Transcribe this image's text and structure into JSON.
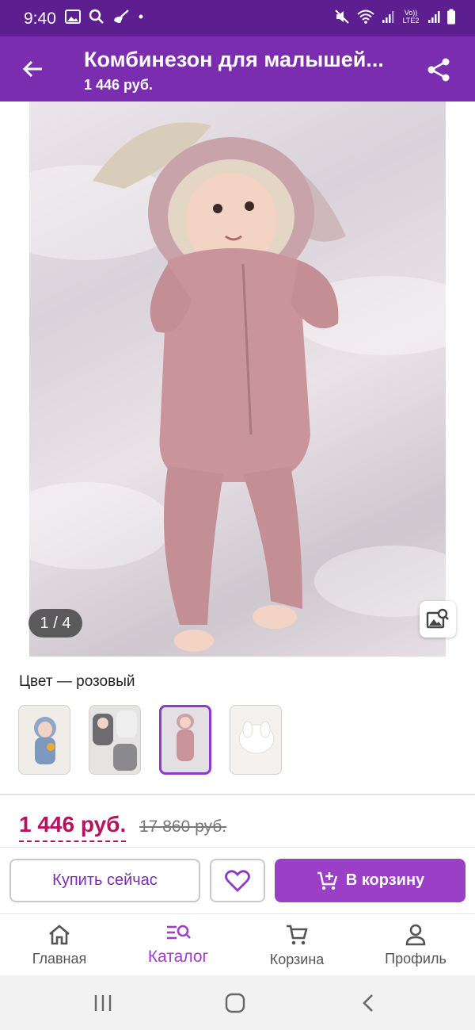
{
  "status_bar": {
    "time": "9:40",
    "left_icons": [
      "gallery-icon",
      "search-icon",
      "broom-icon",
      "dot-icon"
    ],
    "right_icons": [
      "mute-icon",
      "wifi-icon",
      "signal-icon",
      "lte-icon",
      "signal-icon",
      "battery-icon"
    ],
    "lte_label": "Vo)) LTE2"
  },
  "app_bar": {
    "title": "Комбинезон для малышей...",
    "subtitle": "1 446 руб.",
    "back_icon": "arrow-left-icon",
    "share_icon": "share-icon"
  },
  "gallery": {
    "counter": "1 / 4",
    "image_search_icon": "image-search-icon"
  },
  "color": {
    "label": "Цвет — розовый",
    "variants": [
      {
        "name": "blue",
        "selected": false
      },
      {
        "name": "grey",
        "selected": false
      },
      {
        "name": "pink",
        "selected": true
      },
      {
        "name": "white",
        "selected": false
      }
    ]
  },
  "pricing": {
    "price": "1 446 руб.",
    "old_price": "17 860 руб."
  },
  "actions": {
    "buy_now": "Купить сейчас",
    "add_to_cart": "В корзину"
  },
  "bottom_nav": {
    "items": [
      {
        "label": "Главная",
        "icon": "home-icon",
        "active": false
      },
      {
        "label": "Каталог",
        "icon": "catalog-search-icon",
        "active": true
      },
      {
        "label": "Корзина",
        "icon": "cart-icon",
        "active": false
      },
      {
        "label": "Профиль",
        "icon": "profile-icon",
        "active": false
      }
    ]
  },
  "colors": {
    "status_bar": "#5d1f8f",
    "app_bar": "#7b2db0",
    "accent": "#9c3fc7",
    "price": "#b5125f"
  }
}
